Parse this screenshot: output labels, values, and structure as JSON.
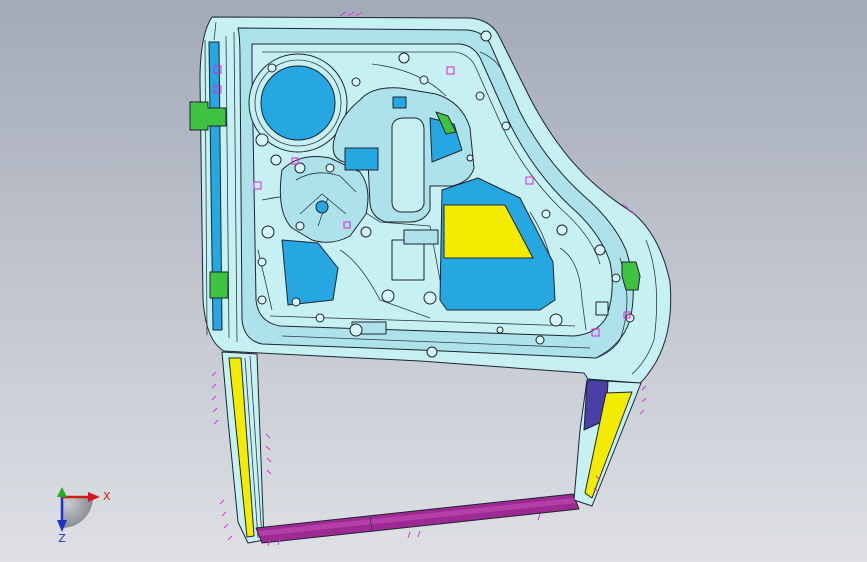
{
  "viewport": {
    "background_top": "#a3aab7",
    "background_bottom": "#dee0e5"
  },
  "model": {
    "name": "",
    "colors": {
      "panel": "#c7f0f2",
      "inner": "#aee2ea",
      "cutout": "#27a7e2",
      "highlight": "#f4ec00",
      "frame": "#9d2a92",
      "frame_light": "#b53fa9",
      "hinge": "#3fc23f",
      "bracket": "#4a3fa6",
      "marker": "#e21fe0",
      "weld": "#d23bd0"
    }
  },
  "triad": {
    "icon": "coordinate-triad-icon",
    "x_label": "X",
    "z_label": "Z",
    "x_color": "#d21a1a",
    "y_color": "#1eb01e",
    "z_color": "#1a34c8",
    "disc_color": "#8e9196"
  }
}
